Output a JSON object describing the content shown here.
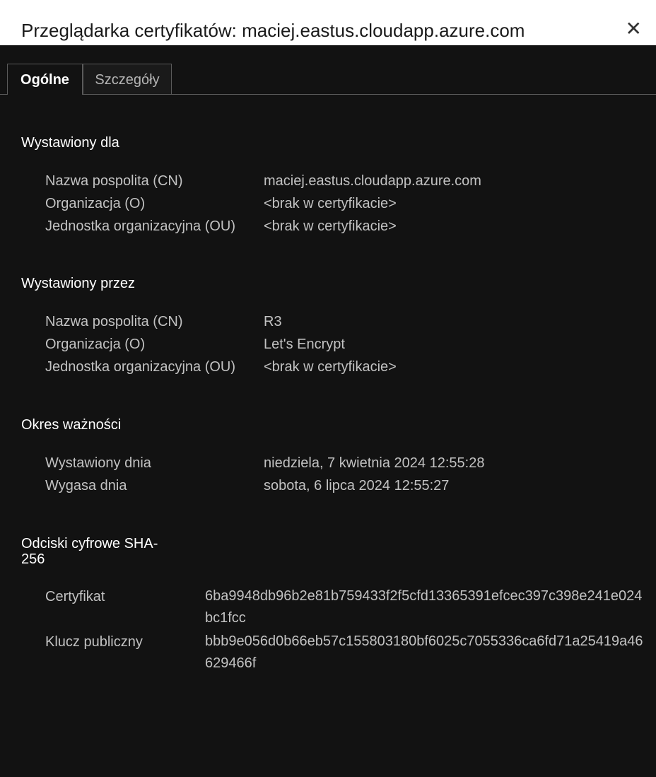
{
  "dialog": {
    "title": "Przeglądarka certyfikatów: maciej.eastus.cloudapp.azure.com",
    "close_label": "✕"
  },
  "tabs": [
    {
      "label": "Ogólne",
      "active": true
    },
    {
      "label": "Szczegóły",
      "active": false
    }
  ],
  "issued_to": {
    "heading": "Wystawiony dla",
    "rows": [
      {
        "label": "Nazwa pospolita (CN)",
        "value": "maciej.eastus.cloudapp.azure.com"
      },
      {
        "label": "Organizacja (O)",
        "value": "<brak w certyfikacie>"
      },
      {
        "label": "Jednostka organizacyjna (OU)",
        "value": "<brak w certyfikacie>"
      }
    ]
  },
  "issued_by": {
    "heading": "Wystawiony przez",
    "rows": [
      {
        "label": "Nazwa pospolita (CN)",
        "value": "R3"
      },
      {
        "label": "Organizacja (O)",
        "value": "Let's Encrypt"
      },
      {
        "label": "Jednostka organizacyjna (OU)",
        "value": "<brak w certyfikacie>"
      }
    ]
  },
  "validity": {
    "heading": "Okres ważności",
    "rows": [
      {
        "label": "Wystawiony dnia",
        "value": "niedziela, 7 kwietnia 2024 12:55:28"
      },
      {
        "label": "Wygasa dnia",
        "value": "sobota, 6 lipca 2024 12:55:27"
      }
    ]
  },
  "fingerprints": {
    "heading_line1": "Odciski cyfrowe SHA-",
    "heading_line2": "256",
    "rows": [
      {
        "label": "Certyfikat",
        "value": "6ba9948db96b2e81b759433f2f5cfd13365391efcec397c398e241e024bc1fcc"
      },
      {
        "label": "Klucz publiczny",
        "value": "bbb9e056d0b66eb57c155803180bf6025c7055336ca6fd71a25419a46629466f"
      }
    ]
  }
}
